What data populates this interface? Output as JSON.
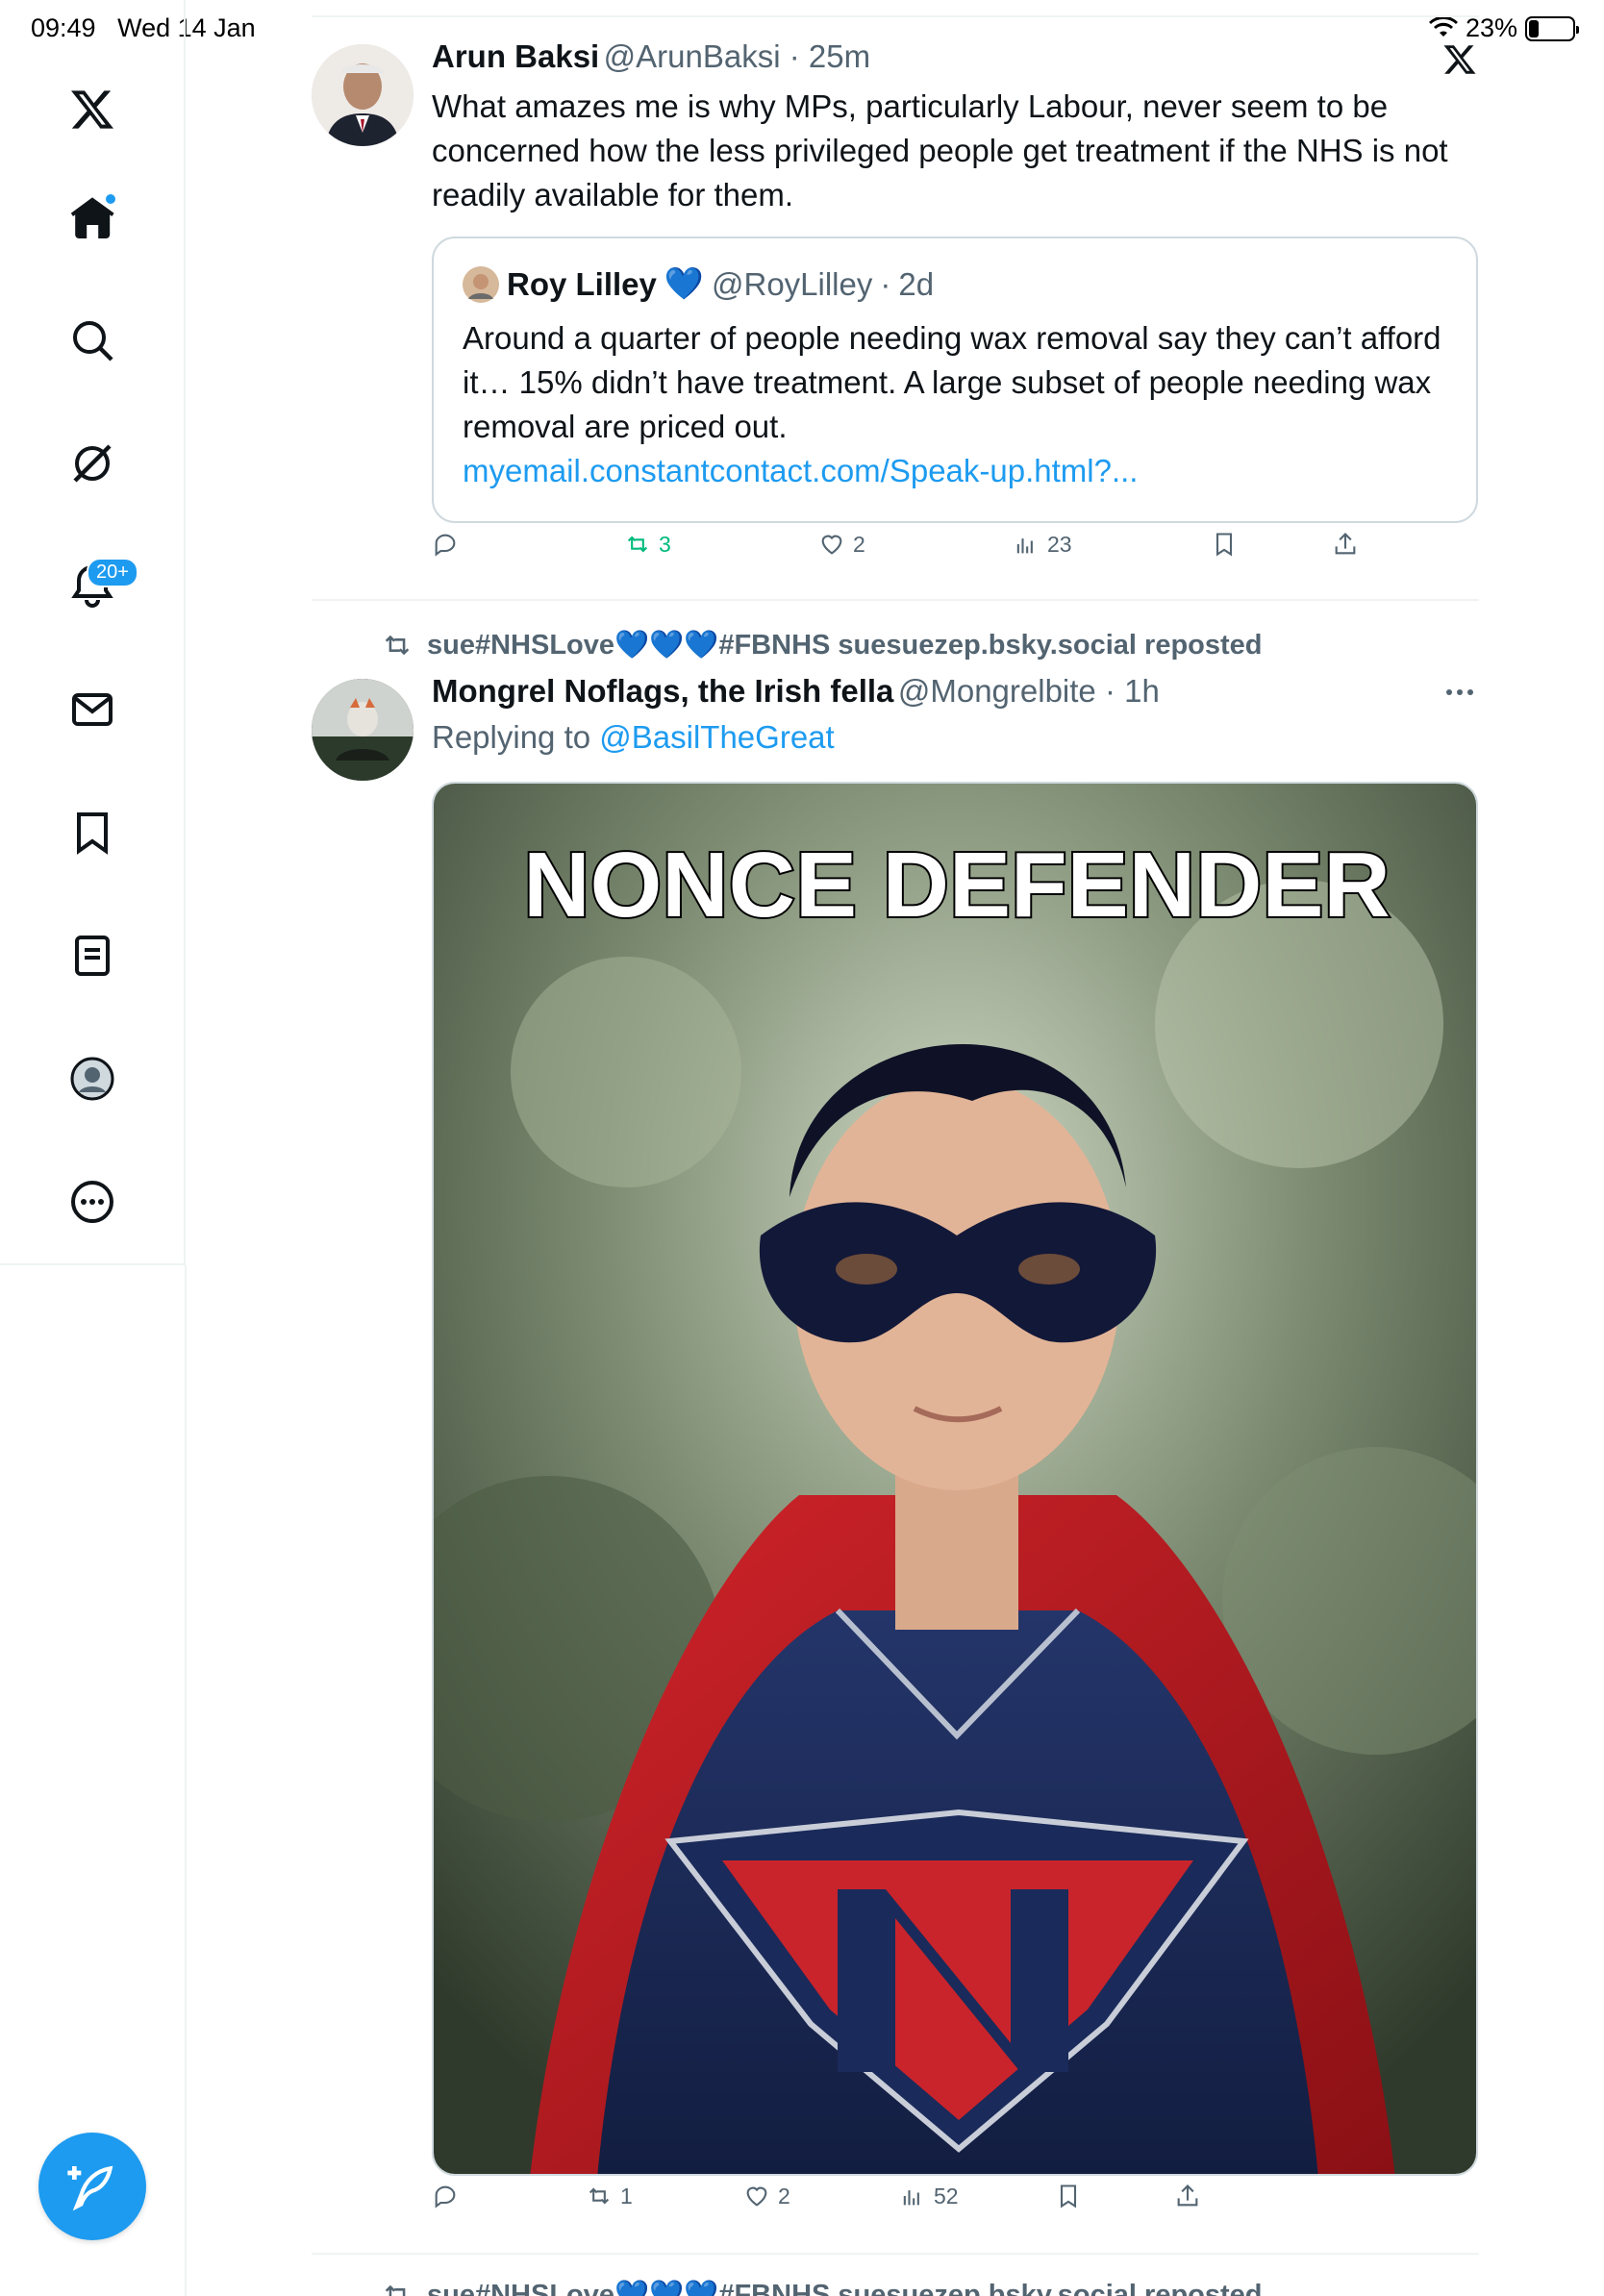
{
  "status_bar": {
    "time": "09:49",
    "date": "Wed 14 Jan",
    "battery": "23%",
    "battery_level": 0.23
  },
  "sidebar": {
    "items": [
      {
        "name": "x-logo",
        "icon": "x-logo-icon"
      },
      {
        "name": "home",
        "icon": "home-icon"
      },
      {
        "name": "search",
        "icon": "search-icon"
      },
      {
        "name": "grok",
        "icon": "grok-icon"
      },
      {
        "name": "notifications",
        "icon": "bell-icon",
        "badge": "20+"
      },
      {
        "name": "messages",
        "icon": "mail-icon"
      },
      {
        "name": "bookmarks",
        "icon": "bookmark-icon"
      },
      {
        "name": "lists",
        "icon": "list-icon"
      },
      {
        "name": "profile",
        "icon": "profile-icon"
      },
      {
        "name": "more",
        "icon": "more-icon"
      }
    ],
    "compose_icon": "compose-icon"
  },
  "tweet1": {
    "name": "Arun Baksi",
    "handle": "@ArunBaksi",
    "time": "25m",
    "text": "What amazes me is why MPs, particularly Labour, never seem to be concerned how the less privileged people get treatment if the NHS is not readily available for them.",
    "quote": {
      "name": "Roy Lilley",
      "emoji": "💙",
      "handle": "@RoyLilley",
      "time": "2d",
      "text": "Around a quarter of people needing wax removal say they can’t afford it… 15% didn’t have treatment. A large subset of people needing wax removal are priced out.",
      "link": "myemail.constantcontact.com/Speak-up.html?..."
    },
    "reposts": "3",
    "likes": "2",
    "views": "23"
  },
  "tweet2": {
    "repost_line": "sue#NHSLove💙💙💙#FBNHS suesuezep.bsky.social reposted",
    "name": "Mongrel Noflags, the Irish fella",
    "handle": "@Mongrelbite",
    "time": "1h",
    "replying_prefix": "Replying to ",
    "replying_to": "@BasilTheGreat",
    "image_caption": "NONCE DEFENDER",
    "reposts": "1",
    "likes": "2",
    "views": "52"
  },
  "tweet3_partial": {
    "repost_line": "sue#NHSLove💙💙💙#FBNHS suesuezep.bsky.social reposted"
  },
  "colors": {
    "accent": "#1d9bf0",
    "repost_green": "#00ba7c",
    "muted": "#536471"
  }
}
